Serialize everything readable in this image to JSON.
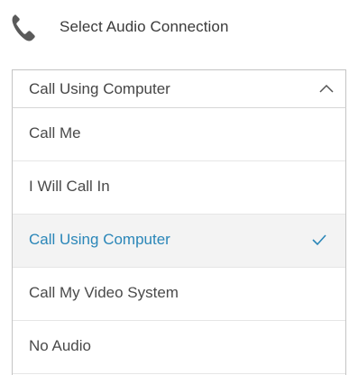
{
  "header": {
    "title": "Select Audio Connection",
    "icon": "phone-icon"
  },
  "select": {
    "value": "Call Using Computer",
    "icon": "chevron-up-icon"
  },
  "options": [
    {
      "label": "Call Me",
      "selected": false
    },
    {
      "label": "I Will Call In",
      "selected": false
    },
    {
      "label": "Call Using Computer",
      "selected": true
    },
    {
      "label": "Call My Video System",
      "selected": false
    },
    {
      "label": "No Audio",
      "selected": false
    }
  ],
  "colors": {
    "accent": "#2a86b8",
    "selected_bg": "#f3f3f3",
    "text": "#4a4a4a",
    "border": "#c4c4c4"
  }
}
